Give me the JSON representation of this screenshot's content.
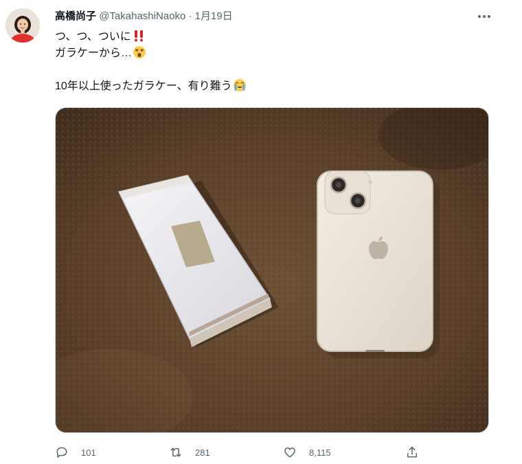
{
  "tweet": {
    "display_name": "高橋尚子",
    "handle": "@TakahashiNaoko",
    "separator": "·",
    "date": "1月19日",
    "text_lines": [
      "つ、つ、ついに",
      "ガラケーから…",
      "",
      "10年以上使ったガラケー、有り難う"
    ],
    "emojis": [
      "double-exclamation-icon",
      "dizzy-face-icon",
      "loudly-crying-face-icon"
    ]
  },
  "media": {
    "description_icon": "photo-flip-phone-and-smartphone"
  },
  "actions": {
    "reply_count": "101",
    "retweet_count": "281",
    "like_count": "8,115"
  },
  "colors": {
    "secondary_text": "#536471",
    "primary_text": "#0f1419",
    "border": "#cfd9de",
    "exclamation_red": "#d8232a",
    "carpet_brown": "#5e4530"
  }
}
